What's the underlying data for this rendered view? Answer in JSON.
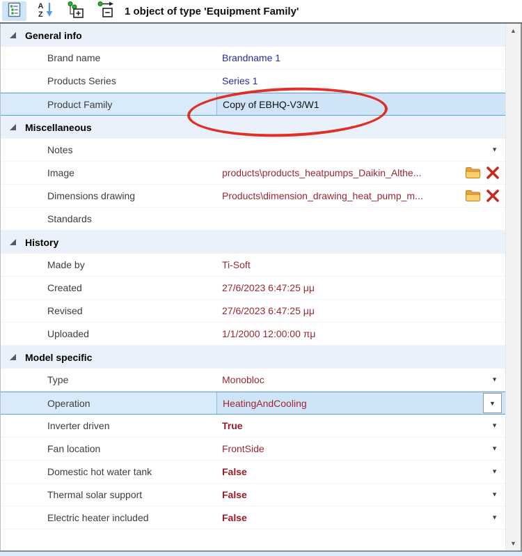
{
  "toolbar": {
    "title": "1 object of type 'Equipment Family'"
  },
  "icons": {
    "up_arrow": "▲",
    "down_arrow": "▼",
    "dropdown_arrow": "▼"
  },
  "colors": {
    "selection_bg": "#cfe5f7",
    "selection_border": "#56a1d8",
    "category_bg": "#eaf1fa",
    "value_navy": "#2b2ba6",
    "value_maroon": "#9c2734",
    "annotation_red": "#dd1f13",
    "folder_icon_orange": "#f5b64a",
    "delete_icon_red": "#c9291b"
  },
  "grid": {
    "sections": [
      {
        "title": "General info",
        "rows": [
          {
            "label": "Brand name",
            "value": "Brandname 1",
            "style": "navy"
          },
          {
            "label": "Products Series",
            "value": "Series 1",
            "style": "navy"
          },
          {
            "label": "Product Family",
            "value": "Copy of EBHQ-V3/W1",
            "style": "black",
            "selected": true,
            "annotated": true
          }
        ]
      },
      {
        "title": "Miscellaneous",
        "rows": [
          {
            "label": "Notes",
            "value": "",
            "style": "black",
            "dropdown": true
          },
          {
            "label": "Image",
            "value": "products\\products_heatpumps_Daikin_Althe...",
            "style": "maroon",
            "file_actions": true
          },
          {
            "label": "Dimensions drawing",
            "value": "Products\\dimension_drawing_heat_pump_m...",
            "style": "maroon",
            "file_actions": true
          },
          {
            "label": "Standards",
            "value": "",
            "style": "black"
          }
        ]
      },
      {
        "title": "History",
        "rows": [
          {
            "label": "Made by",
            "value": "Ti-Soft",
            "style": "maroon"
          },
          {
            "label": "Created",
            "value": "27/6/2023 6:47:25 μμ",
            "style": "maroon"
          },
          {
            "label": "Revised",
            "value": "27/6/2023 6:47:25 μμ",
            "style": "maroon"
          },
          {
            "label": "Uploaded",
            "value": "1/1/2000 12:00:00 πμ",
            "style": "maroon"
          }
        ]
      },
      {
        "title": "Model specific",
        "rows": [
          {
            "label": "Type",
            "value": "Monobloc",
            "style": "maroon",
            "dropdown": true
          },
          {
            "label": "Operation",
            "value": "HeatingAndCooling",
            "style": "maroon",
            "selected": true,
            "combo": true
          },
          {
            "label": "Inverter driven",
            "value": "True",
            "style": "maroon-bold",
            "dropdown": true
          },
          {
            "label": "Fan location",
            "value": "FrontSide",
            "style": "maroon",
            "dropdown": true
          },
          {
            "label": "Domestic hot water tank",
            "value": "False",
            "style": "maroon-bold",
            "dropdown": true
          },
          {
            "label": "Thermal solar support",
            "value": "False",
            "style": "maroon-bold",
            "dropdown": true
          },
          {
            "label": "Electric heater included",
            "value": "False",
            "style": "maroon-bold",
            "dropdown": true
          }
        ]
      }
    ]
  }
}
